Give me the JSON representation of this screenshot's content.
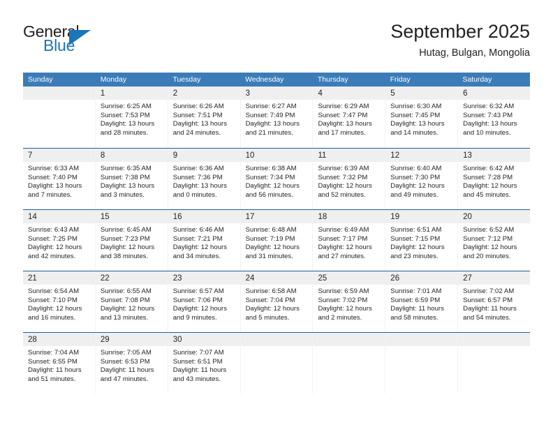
{
  "brand": {
    "general": "General",
    "blue": "Blue",
    "triangle_icon": "triangle-icon"
  },
  "header": {
    "title": "September 2025",
    "subtitle": "Hutag, Bulgan, Mongolia"
  },
  "colors": {
    "header_blue": "#3b7cb8",
    "row_separator": "#1f5f9e",
    "day_band": "#efefef",
    "brand_blue": "#1b75bb",
    "text": "#231f20"
  },
  "calendar": {
    "day_headers": [
      "Sunday",
      "Monday",
      "Tuesday",
      "Wednesday",
      "Thursday",
      "Friday",
      "Saturday"
    ],
    "weeks": [
      [
        {
          "day": "",
          "sunrise": "",
          "sunset": "",
          "daylight_line1": "",
          "daylight_line2": ""
        },
        {
          "day": "1",
          "sunrise": "Sunrise: 6:25 AM",
          "sunset": "Sunset: 7:53 PM",
          "daylight_line1": "Daylight: 13 hours",
          "daylight_line2": "and 28 minutes."
        },
        {
          "day": "2",
          "sunrise": "Sunrise: 6:26 AM",
          "sunset": "Sunset: 7:51 PM",
          "daylight_line1": "Daylight: 13 hours",
          "daylight_line2": "and 24 minutes."
        },
        {
          "day": "3",
          "sunrise": "Sunrise: 6:27 AM",
          "sunset": "Sunset: 7:49 PM",
          "daylight_line1": "Daylight: 13 hours",
          "daylight_line2": "and 21 minutes."
        },
        {
          "day": "4",
          "sunrise": "Sunrise: 6:29 AM",
          "sunset": "Sunset: 7:47 PM",
          "daylight_line1": "Daylight: 13 hours",
          "daylight_line2": "and 17 minutes."
        },
        {
          "day": "5",
          "sunrise": "Sunrise: 6:30 AM",
          "sunset": "Sunset: 7:45 PM",
          "daylight_line1": "Daylight: 13 hours",
          "daylight_line2": "and 14 minutes."
        },
        {
          "day": "6",
          "sunrise": "Sunrise: 6:32 AM",
          "sunset": "Sunset: 7:43 PM",
          "daylight_line1": "Daylight: 13 hours",
          "daylight_line2": "and 10 minutes."
        }
      ],
      [
        {
          "day": "7",
          "sunrise": "Sunrise: 6:33 AM",
          "sunset": "Sunset: 7:40 PM",
          "daylight_line1": "Daylight: 13 hours",
          "daylight_line2": "and 7 minutes."
        },
        {
          "day": "8",
          "sunrise": "Sunrise: 6:35 AM",
          "sunset": "Sunset: 7:38 PM",
          "daylight_line1": "Daylight: 13 hours",
          "daylight_line2": "and 3 minutes."
        },
        {
          "day": "9",
          "sunrise": "Sunrise: 6:36 AM",
          "sunset": "Sunset: 7:36 PM",
          "daylight_line1": "Daylight: 13 hours",
          "daylight_line2": "and 0 minutes."
        },
        {
          "day": "10",
          "sunrise": "Sunrise: 6:38 AM",
          "sunset": "Sunset: 7:34 PM",
          "daylight_line1": "Daylight: 12 hours",
          "daylight_line2": "and 56 minutes."
        },
        {
          "day": "11",
          "sunrise": "Sunrise: 6:39 AM",
          "sunset": "Sunset: 7:32 PM",
          "daylight_line1": "Daylight: 12 hours",
          "daylight_line2": "and 52 minutes."
        },
        {
          "day": "12",
          "sunrise": "Sunrise: 6:40 AM",
          "sunset": "Sunset: 7:30 PM",
          "daylight_line1": "Daylight: 12 hours",
          "daylight_line2": "and 49 minutes."
        },
        {
          "day": "13",
          "sunrise": "Sunrise: 6:42 AM",
          "sunset": "Sunset: 7:28 PM",
          "daylight_line1": "Daylight: 12 hours",
          "daylight_line2": "and 45 minutes."
        }
      ],
      [
        {
          "day": "14",
          "sunrise": "Sunrise: 6:43 AM",
          "sunset": "Sunset: 7:25 PM",
          "daylight_line1": "Daylight: 12 hours",
          "daylight_line2": "and 42 minutes."
        },
        {
          "day": "15",
          "sunrise": "Sunrise: 6:45 AM",
          "sunset": "Sunset: 7:23 PM",
          "daylight_line1": "Daylight: 12 hours",
          "daylight_line2": "and 38 minutes."
        },
        {
          "day": "16",
          "sunrise": "Sunrise: 6:46 AM",
          "sunset": "Sunset: 7:21 PM",
          "daylight_line1": "Daylight: 12 hours",
          "daylight_line2": "and 34 minutes."
        },
        {
          "day": "17",
          "sunrise": "Sunrise: 6:48 AM",
          "sunset": "Sunset: 7:19 PM",
          "daylight_line1": "Daylight: 12 hours",
          "daylight_line2": "and 31 minutes."
        },
        {
          "day": "18",
          "sunrise": "Sunrise: 6:49 AM",
          "sunset": "Sunset: 7:17 PM",
          "daylight_line1": "Daylight: 12 hours",
          "daylight_line2": "and 27 minutes."
        },
        {
          "day": "19",
          "sunrise": "Sunrise: 6:51 AM",
          "sunset": "Sunset: 7:15 PM",
          "daylight_line1": "Daylight: 12 hours",
          "daylight_line2": "and 23 minutes."
        },
        {
          "day": "20",
          "sunrise": "Sunrise: 6:52 AM",
          "sunset": "Sunset: 7:12 PM",
          "daylight_line1": "Daylight: 12 hours",
          "daylight_line2": "and 20 minutes."
        }
      ],
      [
        {
          "day": "21",
          "sunrise": "Sunrise: 6:54 AM",
          "sunset": "Sunset: 7:10 PM",
          "daylight_line1": "Daylight: 12 hours",
          "daylight_line2": "and 16 minutes."
        },
        {
          "day": "22",
          "sunrise": "Sunrise: 6:55 AM",
          "sunset": "Sunset: 7:08 PM",
          "daylight_line1": "Daylight: 12 hours",
          "daylight_line2": "and 13 minutes."
        },
        {
          "day": "23",
          "sunrise": "Sunrise: 6:57 AM",
          "sunset": "Sunset: 7:06 PM",
          "daylight_line1": "Daylight: 12 hours",
          "daylight_line2": "and 9 minutes."
        },
        {
          "day": "24",
          "sunrise": "Sunrise: 6:58 AM",
          "sunset": "Sunset: 7:04 PM",
          "daylight_line1": "Daylight: 12 hours",
          "daylight_line2": "and 5 minutes."
        },
        {
          "day": "25",
          "sunrise": "Sunrise: 6:59 AM",
          "sunset": "Sunset: 7:02 PM",
          "daylight_line1": "Daylight: 12 hours",
          "daylight_line2": "and 2 minutes."
        },
        {
          "day": "26",
          "sunrise": "Sunrise: 7:01 AM",
          "sunset": "Sunset: 6:59 PM",
          "daylight_line1": "Daylight: 11 hours",
          "daylight_line2": "and 58 minutes."
        },
        {
          "day": "27",
          "sunrise": "Sunrise: 7:02 AM",
          "sunset": "Sunset: 6:57 PM",
          "daylight_line1": "Daylight: 11 hours",
          "daylight_line2": "and 54 minutes."
        }
      ],
      [
        {
          "day": "28",
          "sunrise": "Sunrise: 7:04 AM",
          "sunset": "Sunset: 6:55 PM",
          "daylight_line1": "Daylight: 11 hours",
          "daylight_line2": "and 51 minutes."
        },
        {
          "day": "29",
          "sunrise": "Sunrise: 7:05 AM",
          "sunset": "Sunset: 6:53 PM",
          "daylight_line1": "Daylight: 11 hours",
          "daylight_line2": "and 47 minutes."
        },
        {
          "day": "30",
          "sunrise": "Sunrise: 7:07 AM",
          "sunset": "Sunset: 6:51 PM",
          "daylight_line1": "Daylight: 11 hours",
          "daylight_line2": "and 43 minutes."
        },
        {
          "day": "",
          "sunrise": "",
          "sunset": "",
          "daylight_line1": "",
          "daylight_line2": ""
        },
        {
          "day": "",
          "sunrise": "",
          "sunset": "",
          "daylight_line1": "",
          "daylight_line2": ""
        },
        {
          "day": "",
          "sunrise": "",
          "sunset": "",
          "daylight_line1": "",
          "daylight_line2": ""
        },
        {
          "day": "",
          "sunrise": "",
          "sunset": "",
          "daylight_line1": "",
          "daylight_line2": ""
        }
      ]
    ]
  }
}
